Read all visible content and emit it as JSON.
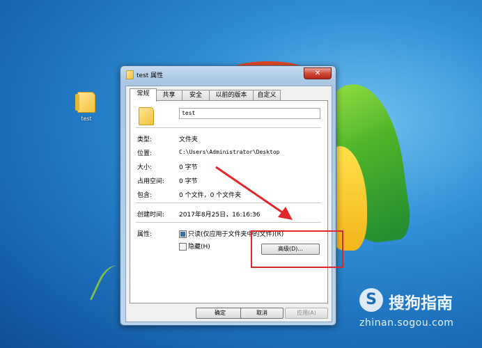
{
  "desktop": {
    "icon_label": "test"
  },
  "dialog": {
    "title": "test 属性",
    "close_label": "✕",
    "tabs": [
      "常规",
      "共享",
      "安全",
      "以前的版本",
      "自定义"
    ],
    "name_value": "test",
    "fields": [
      {
        "label": "类型:",
        "value": "文件夹"
      },
      {
        "label": "位置:",
        "value": "C:\\Users\\Administrator\\Desktop"
      },
      {
        "label": "大小:",
        "value": "0 字节"
      },
      {
        "label": "占用空间:",
        "value": "0 字节"
      },
      {
        "label": "包含:",
        "value": "0 个文件，0 个文件夹"
      }
    ],
    "created_label": "创建时间:",
    "created_value": "2017年8月25日，16:16:36",
    "attributes_label": "属性:",
    "readonly_label": "只读(仅应用于文件夹中的文件)(R)",
    "hidden_label": "隐藏(H)",
    "advanced_label": "高级(D)...",
    "ok_label": "确定",
    "cancel_label": "取消",
    "apply_label": "应用(A)"
  },
  "watermark": {
    "brand": "搜狗指南",
    "url": "zhinan.sogou.com",
    "logo_letter": "S"
  },
  "colors": {
    "highlight_red": "#e0262b",
    "desktop_blue": "#1b6cb8"
  }
}
